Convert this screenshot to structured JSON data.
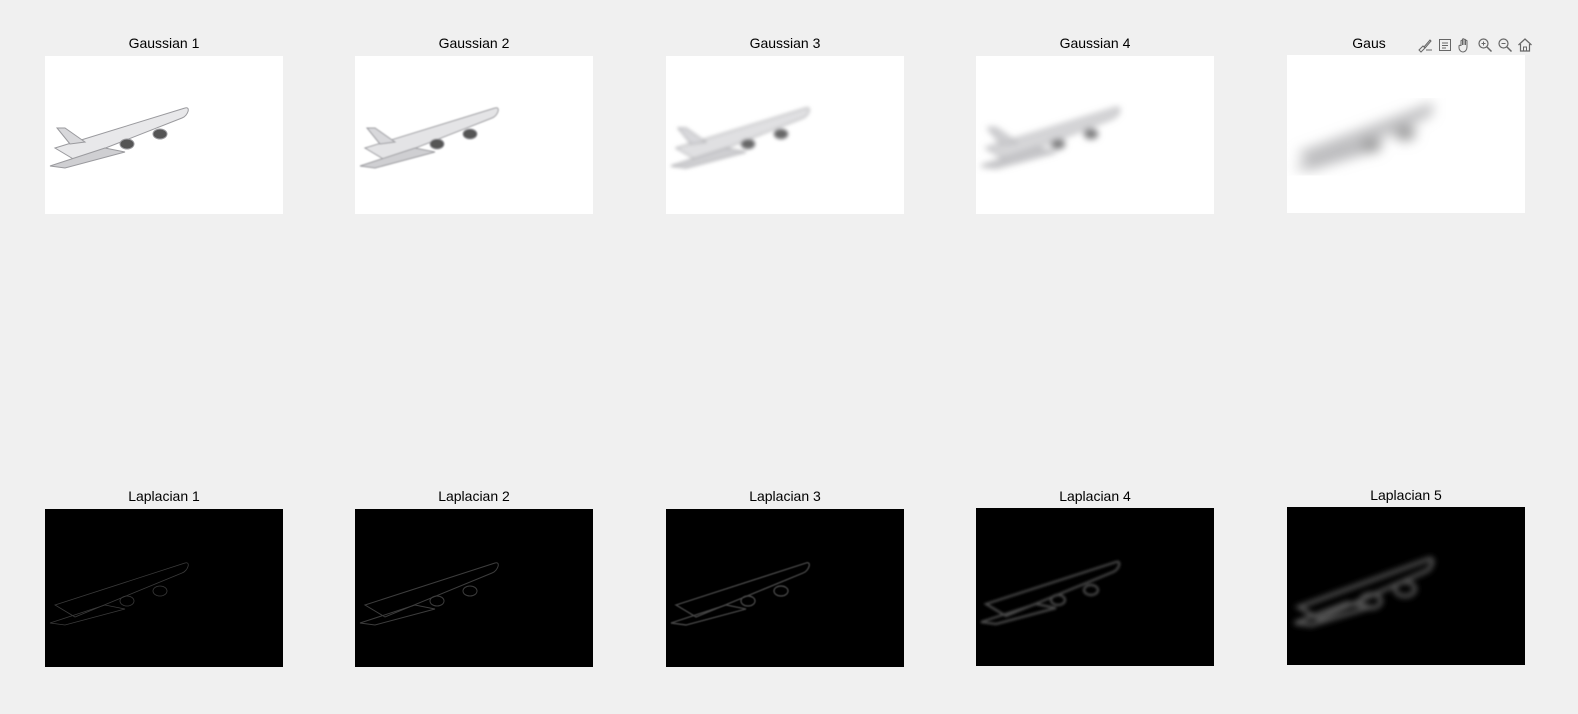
{
  "figure": {
    "gaussian_titles": [
      "Gaussian 1",
      "Gaussian 2",
      "Gaussian 3",
      "Gaussian 4",
      "Gaus"
    ],
    "laplacian_titles": [
      "Laplacian 1",
      "Laplacian 2",
      "Laplacian 3",
      "Laplacian 4",
      "Laplacian 5"
    ]
  },
  "toolbar": {
    "icons": [
      "brush-icon",
      "datatip-icon",
      "pan-hand-icon",
      "zoom-in-icon",
      "zoom-out-icon",
      "home-icon"
    ]
  },
  "colors": {
    "figure_background": "#f0f0f0",
    "gaussian_background": "#ffffff",
    "laplacian_background": "#000000"
  }
}
